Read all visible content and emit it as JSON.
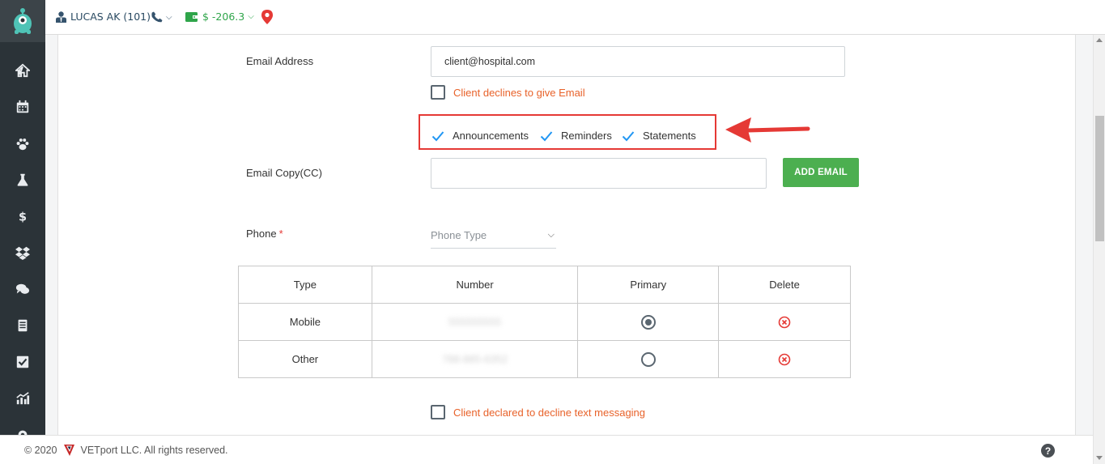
{
  "topbar": {
    "user": "LUCAS AK (101)",
    "balance": "$ -206.3",
    "colors": {
      "balance": "#2fa54a",
      "pin": "#e53935"
    }
  },
  "sidebar": {
    "icons": [
      "home-icon",
      "calendar-icon",
      "paw-icon",
      "flask-icon",
      "dollar-icon",
      "dropbox-icon",
      "chat-icon",
      "report-icon",
      "checklist-icon",
      "analytics-icon",
      "settings-icon"
    ]
  },
  "form": {
    "email_label": "Email Address",
    "email_value": "client@hospital.com",
    "decline_email_label": "Client declines to give Email",
    "subscriptions": [
      "Announcements",
      "Reminders",
      "Statements"
    ],
    "email_cc_label": "Email Copy(CC)",
    "email_cc_value": "",
    "add_email_button": "ADD EMAIL",
    "phone_label": "Phone",
    "phone_required": "*",
    "phone_type_placeholder": "Phone Type",
    "decline_text_label": "Client declared to decline text messaging"
  },
  "phone_table": {
    "headers": [
      "Type",
      "Number",
      "Primary",
      "Delete"
    ],
    "rows": [
      {
        "type": "Mobile",
        "number": "555555555",
        "primary": true
      },
      {
        "type": "Other",
        "number": "788-885-6352",
        "primary": false
      }
    ]
  },
  "footer": {
    "copyright_prefix": "© 2020",
    "copyright_suffix": "VETport LLC. All rights reserved.",
    "help": "?"
  },
  "colors": {
    "sidebar": "#2b3338",
    "accent_green": "#4caf50",
    "orange_text": "#e8622a",
    "highlight_red": "#e53935",
    "check_blue": "#2196f3"
  }
}
